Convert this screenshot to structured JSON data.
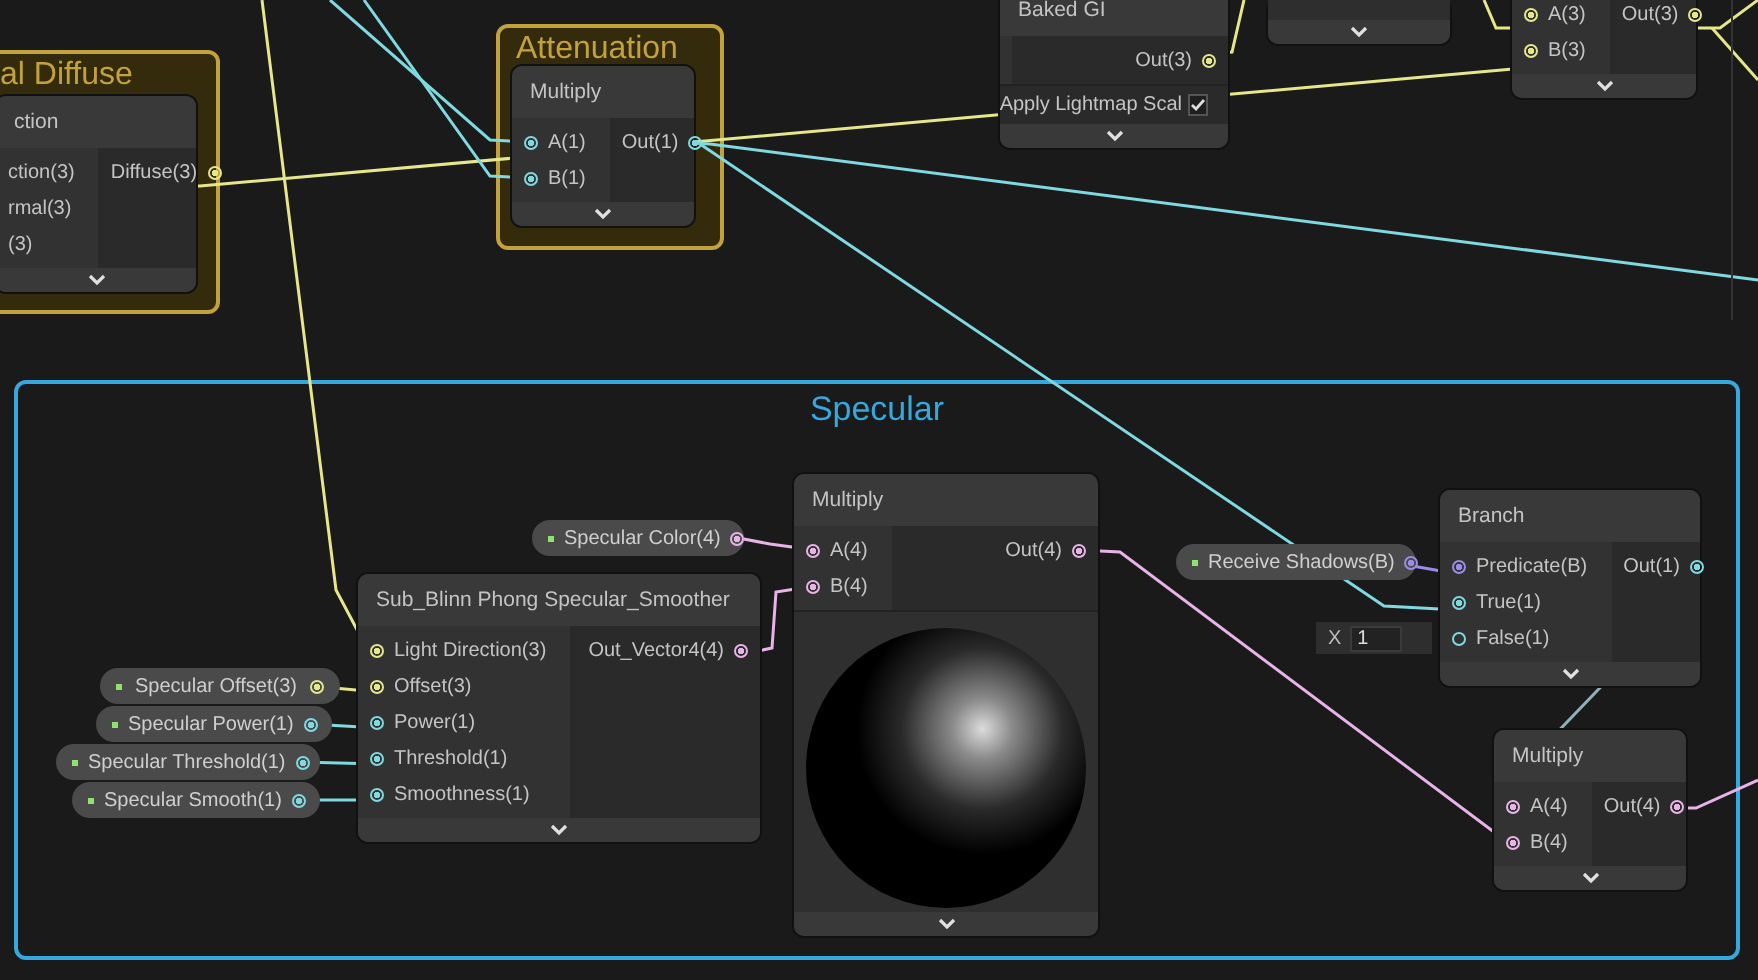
{
  "groups": [
    {
      "title": "al Diffuse",
      "color": "#c2a23c"
    },
    {
      "title": "Attenuation",
      "color": "#c2a23c"
    },
    {
      "title": "Specular",
      "color": "#35a8e0"
    }
  ],
  "nodes": [
    {
      "title": "ction",
      "inputs": [
        {
          "label": "ction(3)"
        },
        {
          "label": "rmal(3)"
        },
        {
          "label": "(3)"
        }
      ],
      "outputs": [
        {
          "label": "Diffuse(3)",
          "color": "#e6e68a",
          "connected": true
        }
      ]
    },
    {
      "title": "Multiply",
      "inputs": [
        {
          "label": "A(1)",
          "color": "#7fd9e0",
          "connected": true
        },
        {
          "label": "B(1)",
          "color": "#7fd9e0",
          "connected": true
        }
      ],
      "outputs": [
        {
          "label": "Out(1)",
          "color": "#7fd9e0",
          "connected": true
        }
      ]
    },
    {
      "title": "Baked GI",
      "outputs": [
        {
          "label": "Out(3)",
          "color": "#e6e68a",
          "connected": true
        }
      ],
      "settings": [
        {
          "label": "Apply Lightmap Scal",
          "checked": true
        }
      ]
    },
    {
      "kind": "stub"
    },
    {
      "inputs": [
        {
          "label": "A(3)",
          "color": "#e6e68a",
          "connected": true
        },
        {
          "label": "B(3)",
          "color": "#e6e68a",
          "connected": true
        }
      ],
      "outputs": [
        {
          "label": "Out(3)",
          "color": "#e6e68a",
          "connected": true
        }
      ]
    },
    {
      "title": "Sub_Blinn Phong Specular_Smoother",
      "inputs": [
        {
          "label": "Light Direction(3)",
          "color": "#e6e68a",
          "connected": true
        },
        {
          "label": "Offset(3)",
          "color": "#e6e68a",
          "connected": true
        },
        {
          "label": "Power(1)",
          "color": "#7fd9e0",
          "connected": true
        },
        {
          "label": "Threshold(1)",
          "color": "#7fd9e0",
          "connected": true
        },
        {
          "label": "Smoothness(1)",
          "color": "#7fd9e0",
          "connected": true
        }
      ],
      "outputs": [
        {
          "label": "Out_Vector4(4)",
          "color": "#e8b4e8",
          "connected": true
        }
      ]
    },
    {
      "title": "Multiply",
      "inputs": [
        {
          "label": "A(4)",
          "color": "#e8b4e8",
          "connected": true
        },
        {
          "label": "B(4)",
          "color": "#e8b4e8",
          "connected": true
        }
      ],
      "outputs": [
        {
          "label": "Out(4)",
          "color": "#e8b4e8",
          "connected": true
        }
      ],
      "preview": true
    },
    {
      "title": "Branch",
      "inputs": [
        {
          "label": "Predicate(B)",
          "color": "#9a8ce8",
          "connected": true
        },
        {
          "label": "True(1)",
          "color": "#7fd9e0",
          "connected": true
        },
        {
          "label": "False(1)",
          "color": "#7fd9e0",
          "connected": false,
          "field": {
            "axis": "X",
            "value": "1"
          }
        }
      ],
      "outputs": [
        {
          "label": "Out(1)",
          "color": "#7fd9e0",
          "connected": true
        }
      ]
    },
    {
      "title": "Multiply",
      "inputs": [
        {
          "label": "A(4)",
          "color": "#e8b4e8",
          "connected": true
        },
        {
          "label": "B(4)",
          "color": "#e8b4e8",
          "connected": true
        }
      ],
      "outputs": [
        {
          "label": "Out(4)",
          "color": "#e8b4e8",
          "connected": true
        }
      ]
    }
  ],
  "properties": [
    {
      "label": "Specular Color(4)",
      "color": "#e8b4e8"
    },
    {
      "label": "Specular Offset(3)",
      "color": "#e6e68a"
    },
    {
      "label": "Specular Power(1)",
      "color": "#7fd9e0"
    },
    {
      "label": "Specular Threshold(1)",
      "color": "#7fd9e0"
    },
    {
      "label": "Specular Smooth(1)",
      "color": "#7fd9e0"
    },
    {
      "label": "Receive Shadows(B)",
      "color": "#9a8ce8"
    }
  ]
}
